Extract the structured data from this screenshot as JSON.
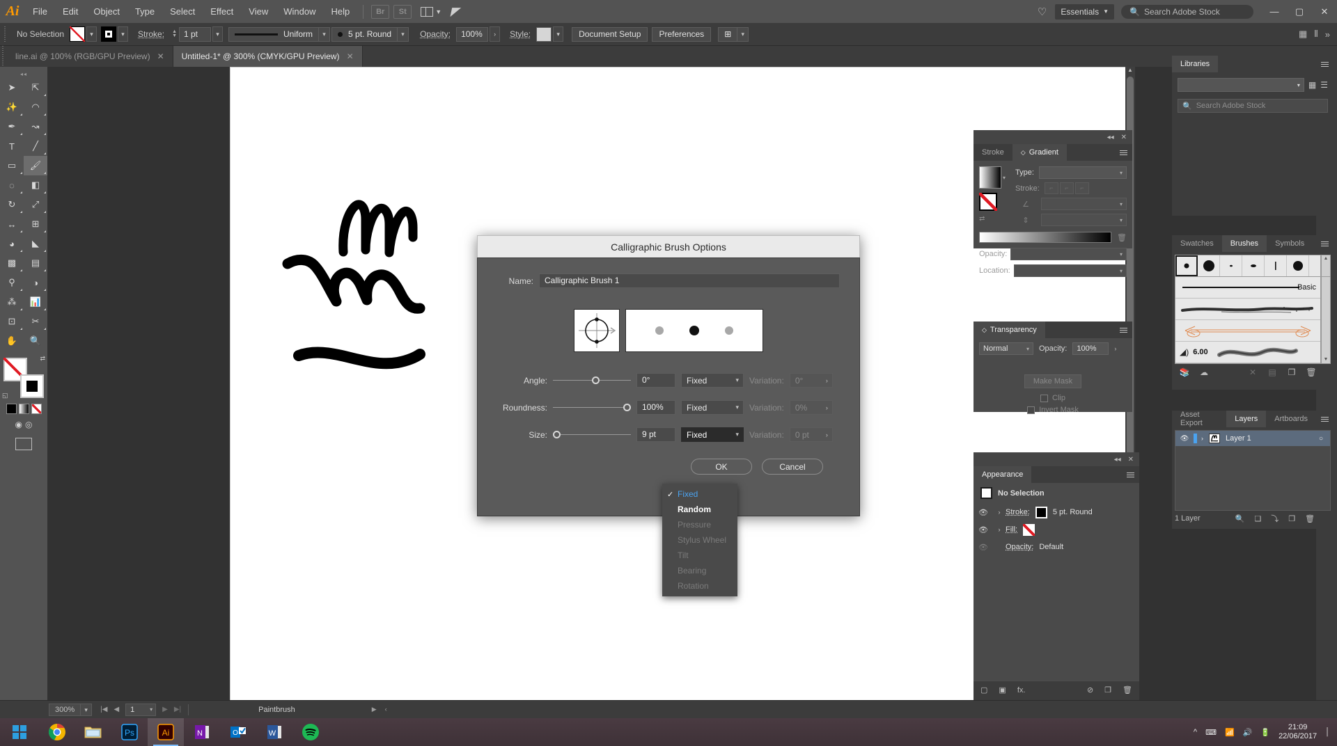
{
  "app": {
    "name": "Adobe Illustrator",
    "logo": "Ai"
  },
  "menubar": {
    "items": [
      "File",
      "Edit",
      "Object",
      "Type",
      "Select",
      "Effect",
      "View",
      "Window",
      "Help"
    ],
    "bridge_label": "Br",
    "stock_label": "St",
    "workspace": "Essentials",
    "search_placeholder": "Search Adobe Stock",
    "minimize": "—",
    "maximize": "▢",
    "close": "✕"
  },
  "controlbar": {
    "selection_status": "No Selection",
    "stroke_label": "Stroke:",
    "stroke_weight": "1 pt",
    "profile": "Uniform",
    "brush": "5 pt. Round",
    "opacity_label": "Opacity:",
    "opacity_value": "100%",
    "style_label": "Style:",
    "document_setup": "Document Setup",
    "preferences": "Preferences"
  },
  "tabs": [
    {
      "title": "line.ai @ 100% (RGB/GPU Preview)",
      "active": false
    },
    {
      "title": "Untitled-1* @ 300% (CMYK/GPU Preview)",
      "active": true
    }
  ],
  "statusbar": {
    "zoom": "300%",
    "page": "1",
    "tool": "Paintbrush"
  },
  "taskbar": {
    "clock_time": "21:09",
    "clock_date": "22/06/2017",
    "apps": [
      "chrome",
      "file-explorer",
      "photoshop",
      "illustrator",
      "onenote",
      "outlook",
      "word",
      "spotify"
    ]
  },
  "dialog": {
    "title": "Calligraphic Brush Options",
    "name_label": "Name:",
    "name_value": "Calligraphic Brush 1",
    "rows": [
      {
        "label": "Angle:",
        "value": "0°",
        "mode": "Fixed",
        "variation_label": "Variation:",
        "variation_value": "0°",
        "slider_pct": 50
      },
      {
        "label": "Roundness:",
        "value": "100%",
        "mode": "Fixed",
        "variation_label": "Variation:",
        "variation_value": "0%",
        "slider_pct": 100
      },
      {
        "label": "Size:",
        "value": "9 pt",
        "mode": "Fixed",
        "variation_label": "Variation:",
        "variation_value": "0 pt",
        "slider_pct": 0
      }
    ],
    "buttons": {
      "ok": "OK",
      "cancel": "Cancel"
    },
    "dropdown": {
      "open": true,
      "items": [
        {
          "label": "Fixed",
          "state": "checked"
        },
        {
          "label": "Random",
          "state": "normal"
        },
        {
          "label": "Pressure",
          "state": "disabled"
        },
        {
          "label": "Stylus Wheel",
          "state": "disabled"
        },
        {
          "label": "Tilt",
          "state": "disabled"
        },
        {
          "label": "Bearing",
          "state": "disabled"
        },
        {
          "label": "Rotation",
          "state": "disabled"
        }
      ]
    }
  },
  "panels": {
    "libraries": {
      "tabs": [
        {
          "label": "Libraries",
          "active": true
        }
      ],
      "selected_library": "",
      "search_placeholder": "Search Adobe Stock"
    },
    "gradient": {
      "tabs": [
        {
          "label": "Stroke",
          "active": false
        },
        {
          "label": "Gradient",
          "active": true
        }
      ],
      "type_label": "Type:",
      "stroke_label": "Stroke:",
      "opacity_label": "Opacity:",
      "location_label": "Location:"
    },
    "transparency": {
      "tabs": [
        {
          "label": "Transparency",
          "active": true
        }
      ],
      "blend_mode": "Normal",
      "opacity_label": "Opacity:",
      "opacity_value": "100%",
      "make_mask": "Make Mask",
      "clip": "Clip",
      "invert_mask": "Invert Mask"
    },
    "appearance": {
      "tabs": [
        {
          "label": "Appearance",
          "active": true
        }
      ],
      "header": "No Selection",
      "rows": [
        {
          "label": "Stroke:",
          "value": "5 pt. Round",
          "visible": true
        },
        {
          "label": "Fill:",
          "value": "",
          "visible": true
        },
        {
          "label": "Opacity:",
          "value": "Default",
          "visible": false
        }
      ]
    },
    "brushes": {
      "tabs": [
        {
          "label": "Swatches",
          "active": false
        },
        {
          "label": "Brushes",
          "active": true
        },
        {
          "label": "Symbols",
          "active": false
        }
      ],
      "basic_label": "Basic",
      "bristle_value": "6.00"
    },
    "layers": {
      "tabs": [
        {
          "label": "Asset Export",
          "active": false
        },
        {
          "label": "Layers",
          "active": true
        },
        {
          "label": "Artboards",
          "active": false
        }
      ],
      "rows": [
        {
          "name": "Layer 1",
          "visible": true,
          "selected": true
        }
      ],
      "footer_count": "1 Layer"
    }
  },
  "tools": {
    "items": [
      "selection-tool",
      "direct-selection-tool",
      "magic-wand-tool",
      "lasso-tool",
      "pen-tool",
      "curvature-tool",
      "type-tool",
      "line-segment-tool",
      "rectangle-tool",
      "paintbrush-tool",
      "shaper-tool",
      "eraser-tool",
      "rotate-tool",
      "scale-tool",
      "width-tool",
      "free-transform-tool",
      "shape-builder-tool",
      "perspective-grid-tool",
      "mesh-tool",
      "gradient-tool",
      "eyedropper-tool",
      "blend-tool",
      "symbol-sprayer-tool",
      "column-graph-tool",
      "artboard-tool",
      "slice-tool",
      "hand-tool",
      "zoom-tool"
    ],
    "selected": "paintbrush-tool"
  },
  "colors": {
    "accent_blue": "#4aa3f0",
    "panel_bg": "#3c3c3c",
    "dialog_bg": "#5a5a5a",
    "titlebar_bg": "#eaeaea",
    "layer_selected": "#5c6b7d",
    "orange": "#ff9a00"
  }
}
